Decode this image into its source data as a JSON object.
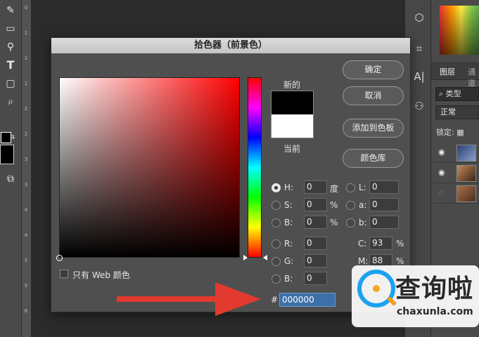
{
  "dialog": {
    "title": "拾色器（前景色）",
    "new_label": "新的",
    "current_label": "当前",
    "new_color": "#000000",
    "current_color": "#ffffff",
    "buttons": {
      "ok": "确定",
      "cancel": "取消",
      "add_to_swatches": "添加到色板",
      "color_libraries": "颜色库"
    },
    "only_web_colors": "只有 Web 颜色",
    "hsb": [
      {
        "label": "H:",
        "value": "0",
        "unit": "度",
        "selected": true
      },
      {
        "label": "S:",
        "value": "0",
        "unit": "%",
        "selected": false
      },
      {
        "label": "B:",
        "value": "0",
        "unit": "%",
        "selected": false
      }
    ],
    "rgb": [
      {
        "label": "R:",
        "value": "0"
      },
      {
        "label": "G:",
        "value": "0"
      },
      {
        "label": "B:",
        "value": "0"
      }
    ],
    "lab": [
      {
        "label": "L:",
        "value": "0"
      },
      {
        "label": "a:",
        "value": "0"
      },
      {
        "label": "b:",
        "value": "0"
      }
    ],
    "cmyk": [
      {
        "label": "C:",
        "value": "93",
        "unit": "%"
      },
      {
        "label": "M:",
        "value": "88",
        "unit": "%"
      }
    ],
    "hex_symbol": "#",
    "hex_value": "000000"
  },
  "right_panel": {
    "layers_tab": "图层",
    "channels_tab": "通道",
    "kind_filter": "类型",
    "blend_mode": "正常",
    "lock_label": "锁定:"
  },
  "ruler_labels": [
    "0",
    "1",
    "1",
    "1",
    "2",
    "2",
    "3",
    "3",
    "4",
    "4",
    "5",
    "5",
    "6"
  ],
  "watermark": {
    "title": "查询啦",
    "subtitle": "chaxunla.com"
  },
  "icons": {
    "toolbar": [
      "brush-icon",
      "eraser-icon",
      "eyedropper-icon",
      "type-icon",
      "rectangle-icon",
      "zoom-icon"
    ],
    "mid_strip": [
      "3d-icon",
      "crop-icon",
      "type-panel-icon",
      "stamp-icon"
    ]
  }
}
